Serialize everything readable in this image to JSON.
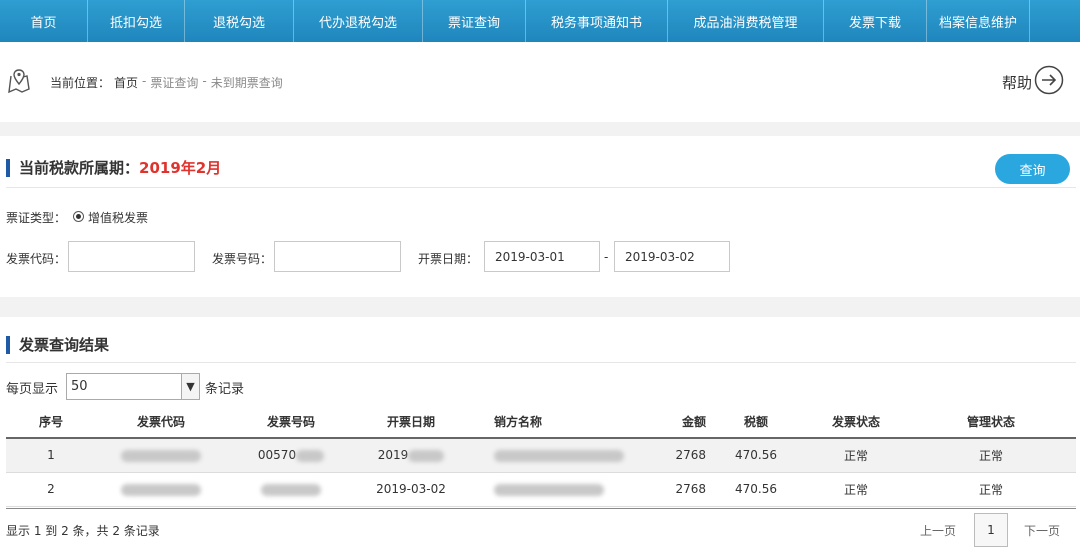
{
  "topnav": {
    "items": [
      "首页",
      "抵扣勾选",
      "退税勾选",
      "代办退税勾选",
      "票证查询",
      "税务事项通知书",
      "成品油消费税管理",
      "发票下载",
      "档案信息维护"
    ],
    "bg_color": "#2391c8"
  },
  "breadcrumb": {
    "prefix": "当前位置：",
    "home": "首页",
    "sep1": "-",
    "level2": "票证查询",
    "sep2": "-",
    "level3": "未到期票查询"
  },
  "help": {
    "label": "帮助"
  },
  "query_section": {
    "title": "当前税款所属期：",
    "period": "2019年2月",
    "query_button": "查询",
    "ticket_type_label": "票证类型：",
    "ticket_type_option": "增值税发票",
    "invoice_code_label": "发票代码：",
    "invoice_code_value": "",
    "invoice_number_label": "发票号码：",
    "invoice_number_value": "",
    "date_label": "开票日期：",
    "date_from": "2019-03-01",
    "date_sep": "-",
    "date_to": "2019-03-02"
  },
  "results": {
    "title": "发票查询结果",
    "per_page_label": "每页显示",
    "per_page_value": "50",
    "per_page_suffix": "条记录",
    "columns": [
      "序号",
      "发票代码",
      "发票号码",
      "开票日期",
      "销方名称",
      "金额",
      "税额",
      "发票状态",
      "管理状态"
    ],
    "rows": [
      {
        "index": "1",
        "code": "",
        "number": "00570",
        "date": "2019",
        "seller": "",
        "amount": "2768",
        "tax": "470.56",
        "invoice_status": "正常",
        "manage_status": "正常"
      },
      {
        "index": "2",
        "code": "",
        "number": "",
        "date": "2019-03-02",
        "seller": "",
        "amount": "2768",
        "tax": "470.56",
        "invoice_status": "正常",
        "manage_status": "正常"
      }
    ],
    "summary": "显示 1 到 2 条，共 2 条记录",
    "prev": "上一页",
    "page": "1",
    "next": "下一页"
  },
  "colors": {
    "accent": "#2aa7df",
    "title_bar": "#1f5aa6",
    "period": "#e0332d"
  }
}
